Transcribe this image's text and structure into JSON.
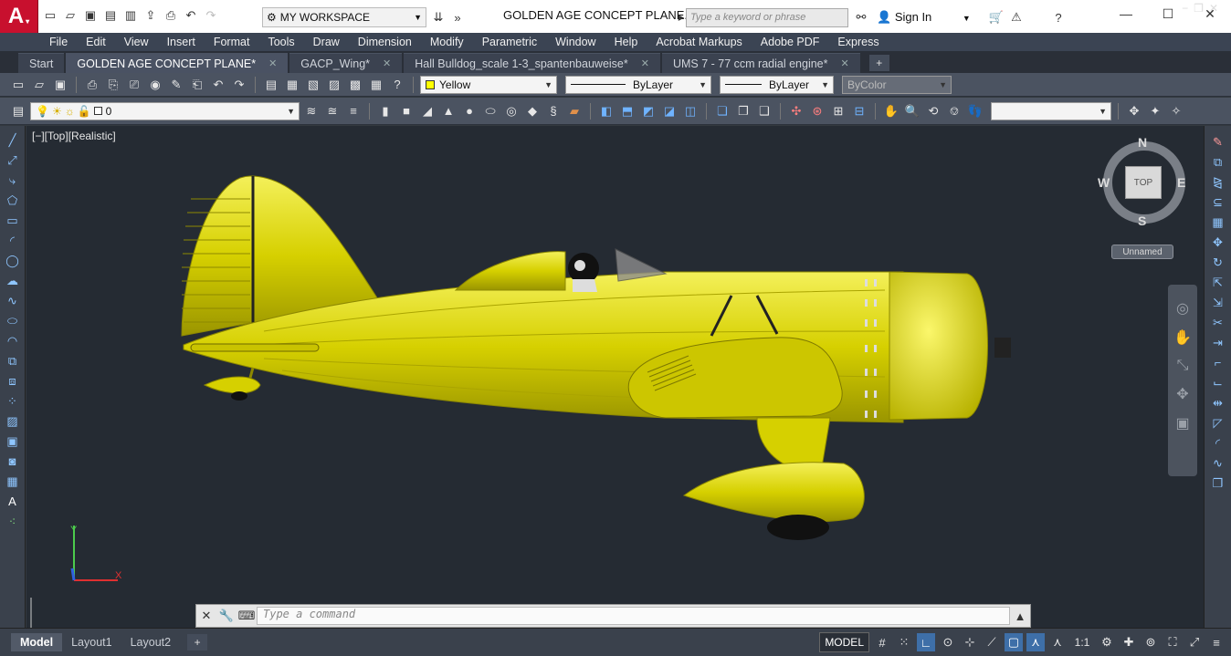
{
  "app": {
    "logo_letter": "A",
    "workspace": "MY WORKSPACE",
    "document_title": "GOLDEN AGE CONCEPT PLANE.d...",
    "search_placeholder": "Type a keyword or phrase",
    "sign_in": "Sign In"
  },
  "menu": [
    "File",
    "Edit",
    "View",
    "Insert",
    "Format",
    "Tools",
    "Draw",
    "Dimension",
    "Modify",
    "Parametric",
    "Window",
    "Help",
    "Acrobat Markups",
    "Adobe PDF",
    "Express"
  ],
  "tabs": [
    {
      "label": "Start",
      "active": false,
      "closable": false
    },
    {
      "label": "GOLDEN AGE CONCEPT PLANE*",
      "active": true,
      "closable": true
    },
    {
      "label": "GACP_Wing*",
      "active": false,
      "closable": true
    },
    {
      "label": "Hall Bulldog_scale 1-3_spantenbauweise*",
      "active": false,
      "closable": true
    },
    {
      "label": "UMS 7 - 77 ccm radial engine*",
      "active": false,
      "closable": true
    }
  ],
  "properties": {
    "color": "Yellow",
    "color_hex": "#ffff00",
    "linetype": "ByLayer",
    "lineweight": "ByLayer",
    "plotstyle": "ByColor"
  },
  "layer": {
    "current": "0"
  },
  "viewport": {
    "label": "[−][Top][Realistic]",
    "viewcube": {
      "N": "N",
      "S": "S",
      "E": "E",
      "W": "W",
      "face": "TOP"
    },
    "ucs": "Unnamed"
  },
  "command": {
    "placeholder": "Type a command"
  },
  "layouts": [
    {
      "label": "Model",
      "active": true
    },
    {
      "label": "Layout1",
      "active": false
    },
    {
      "label": "Layout2",
      "active": false
    }
  ],
  "status": {
    "model": "MODEL",
    "scale": "1:1"
  }
}
